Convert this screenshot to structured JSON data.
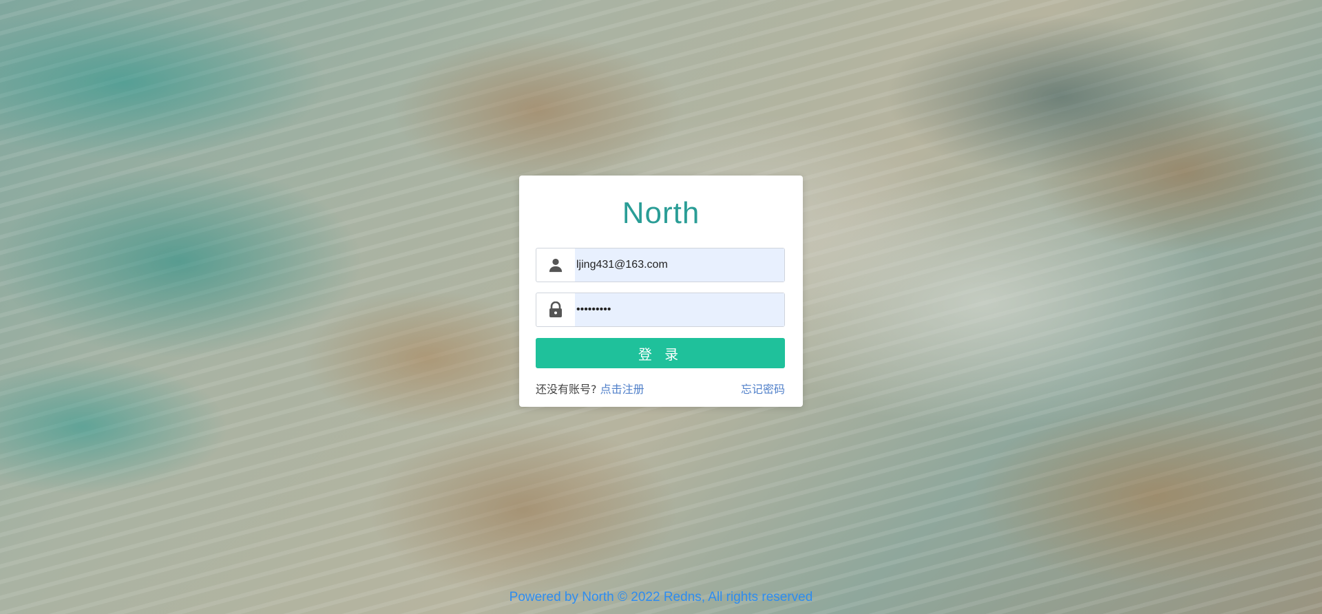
{
  "app": {
    "title": "North"
  },
  "login_form": {
    "username_value": "ljing431@163.com",
    "password_value": "•••••••••",
    "submit_label": "登 录",
    "register_prompt": "还没有账号?",
    "register_link": "点击注册",
    "forgot_link": "忘记密码"
  },
  "icons": {
    "username": "user-icon",
    "password": "lock-icon"
  },
  "colors": {
    "title": "#2a9d96",
    "button": "#1fc19b",
    "link": "#4f7fc9",
    "footer": "#2d8cf0"
  },
  "footer": {
    "text": "Powered by North © 2022 Redns, All rights reserved"
  }
}
